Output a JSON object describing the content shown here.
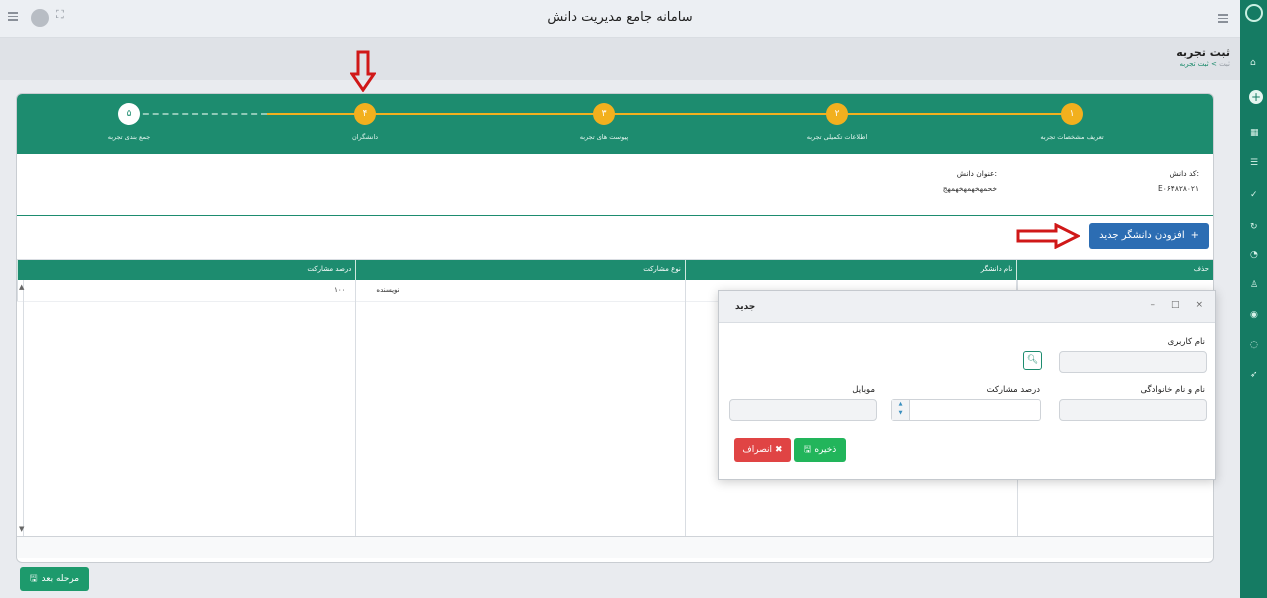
{
  "app": {
    "title": "سامانه جامع مدیریت دانش"
  },
  "page": {
    "title": "ثبت تجربه",
    "breadcrumb": [
      "ثبت",
      "ثبت تجربه"
    ],
    "breadcrumb_sep": ">"
  },
  "steps": [
    {
      "num": "۱",
      "label": "تعریف مشخصات تجربه",
      "state": "done"
    },
    {
      "num": "۲",
      "label": "اطلاعات تکمیلی تجربه",
      "state": "done"
    },
    {
      "num": "۳",
      "label": "پیوست های تجربه",
      "state": "done"
    },
    {
      "num": "۴",
      "label": "دانشگران",
      "state": "current"
    },
    {
      "num": "۵",
      "label": "جمع بندی تجربه",
      "state": "pending"
    }
  ],
  "info": {
    "code_label": "کد دانش:",
    "code_value": "E۰۶۴۸۲۸۰۲۱",
    "title_label": "عنوان دانش:",
    "title_value": "خحمهخهمهخهمهج"
  },
  "toolbar": {
    "add_label": "افزودن دانشگر جدید",
    "add_icon": "+"
  },
  "grid": {
    "headers": [
      "حذف",
      "نام دانشگر",
      "نوع مشارکت",
      "درصد مشارکت"
    ],
    "rows": [
      {
        "type": "نویسنده",
        "percent": "۱۰۰"
      }
    ]
  },
  "next_button": {
    "label": "مرحله بعد"
  },
  "modal": {
    "title": "جدید",
    "username_label": "نام کاربری",
    "fullname_label": "نام و نام خانوادگی",
    "percent_label": "درصد مشارکت",
    "mobile_label": "موبایل",
    "save_label": "ذخیره",
    "cancel_label": "انصراف",
    "controls": {
      "close": "×",
      "maximize": "□",
      "minimize": "–"
    }
  },
  "colors": {
    "primary": "#1d8c6f",
    "accent": "#f2b01e",
    "add_button": "#2c6db3",
    "save": "#22b55b",
    "cancel": "#e04444",
    "annotation": "#d01818"
  }
}
